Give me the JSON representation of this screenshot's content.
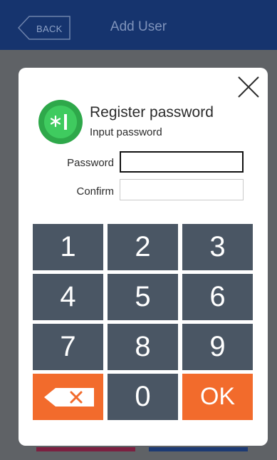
{
  "header": {
    "back_label": "BACK",
    "title": "Add User"
  },
  "dialog": {
    "badge_icon": "password-key-icon",
    "title": "Register password",
    "subtitle": "Input password",
    "close_icon": "close-icon"
  },
  "form": {
    "password_label": "Password",
    "password_value": "",
    "confirm_label": "Confirm",
    "confirm_value": ""
  },
  "keypad": {
    "keys": [
      "1",
      "2",
      "3",
      "4",
      "5",
      "6",
      "7",
      "8",
      "9"
    ],
    "zero_label": "0",
    "ok_label": "OK",
    "backspace_icon": "backspace-icon"
  },
  "colors": {
    "header": "#16346e",
    "key": "#4a5664",
    "accent": "#f26b2c",
    "badge": "#3fcb5f"
  }
}
